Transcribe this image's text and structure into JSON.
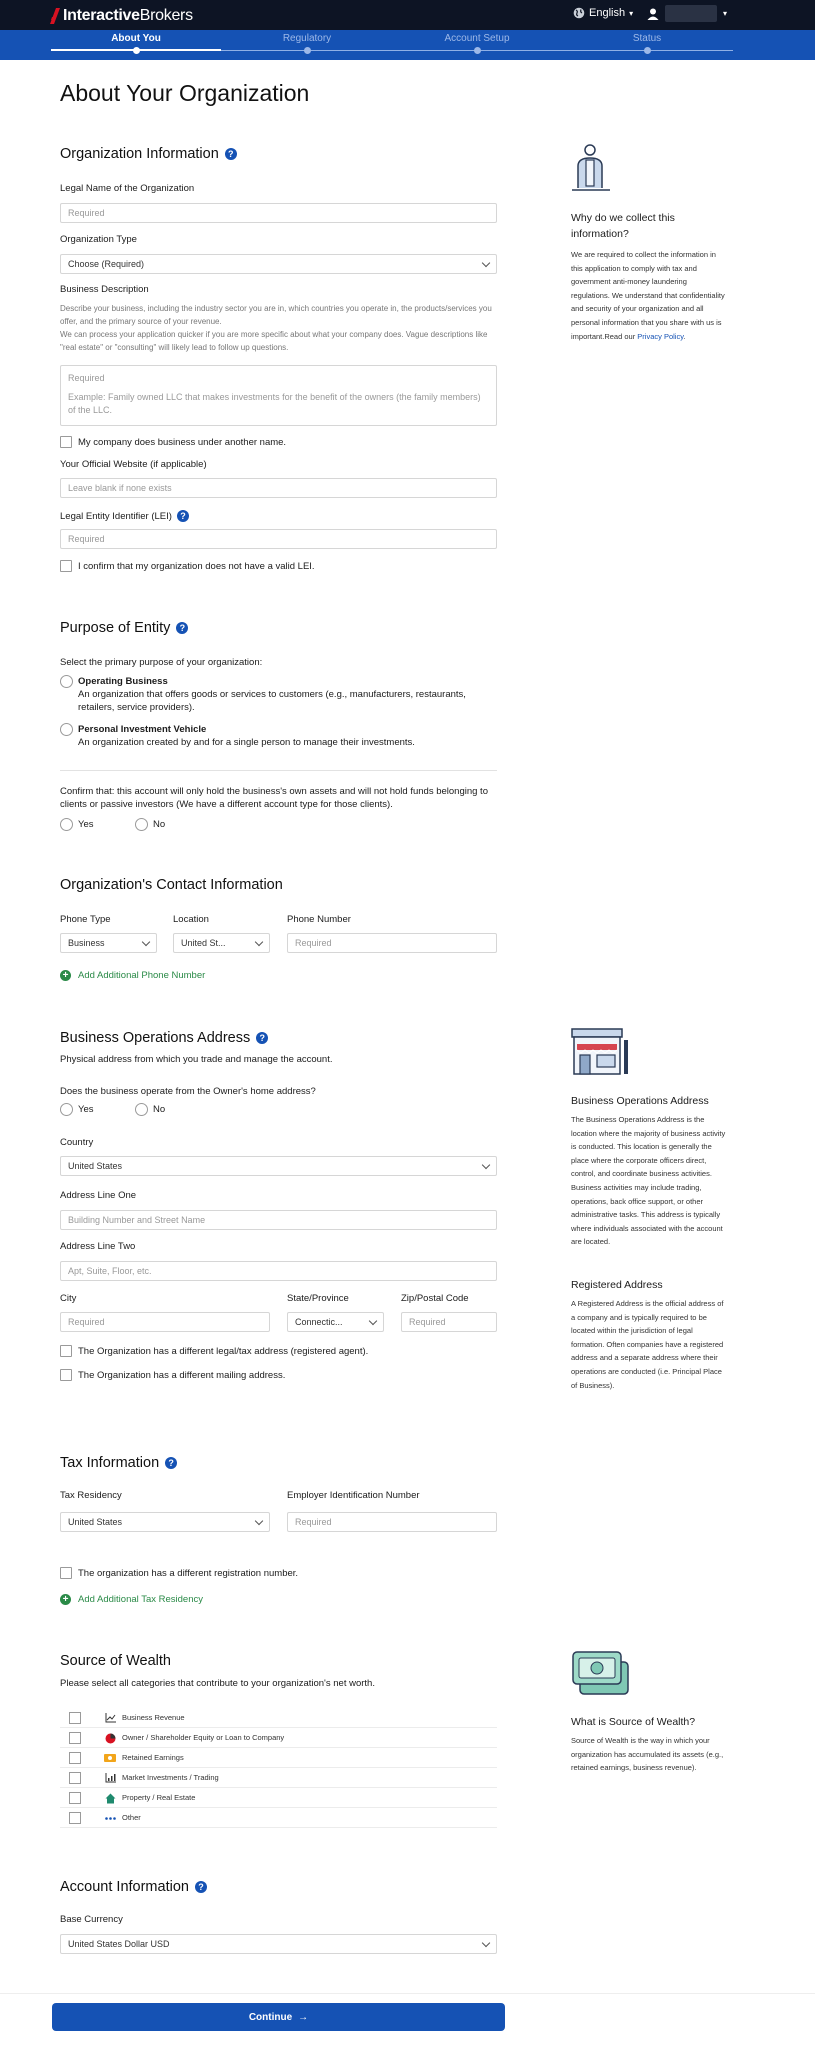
{
  "header": {
    "logo_bold": "Interactive",
    "logo_rest": "Brokers",
    "language": "English",
    "colors": {
      "topbar": "#0d1424",
      "brand_red": "#d81222",
      "primary": "#1552b4",
      "green": "#2a8a47"
    }
  },
  "steps": [
    {
      "label": "About You",
      "active": true
    },
    {
      "label": "Regulatory",
      "active": false
    },
    {
      "label": "Account Setup",
      "active": false
    },
    {
      "label": "Status",
      "active": false
    }
  ],
  "page_title": "About Your Organization",
  "org_info": {
    "heading": "Organization Information",
    "legal_name_label": "Legal Name of the Organization",
    "legal_name_placeholder": "Required",
    "org_type_label": "Organization Type",
    "org_type_value": "Choose (Required)",
    "business_desc_label": "Business Description",
    "business_desc_help_1": "Describe your business, including the industry sector you are in, which countries you operate in, the products/services you offer, and the primary source of your revenue.",
    "business_desc_help_2": "We can process your application quicker if you are more specific about what your company does. Vague descriptions like \"real estate\" or \"consulting\" will likely lead to follow up questions.",
    "business_desc_placeholder_1": "Required",
    "business_desc_placeholder_2": "Example: Family owned LLC that makes investments for the benefit of the owners (the family members) of the LLC.",
    "another_name_label": "My company does business under another name.",
    "website_label": "Your Official Website (if applicable)",
    "website_placeholder": "Leave blank if none exists",
    "lei_label": "Legal Entity Identifier (LEI)",
    "lei_placeholder": "Required",
    "no_lei_label": "I confirm that my organization does not have a valid LEI."
  },
  "side_why": {
    "title": "Why do we collect this information?",
    "text": "We are required to collect the information in this application to comply with tax and government anti-money laundering regulations. We understand that confidentiality and security of your organization and all personal information that you share with us is important.Read our ",
    "link": "Privacy Policy",
    "after": "."
  },
  "purpose": {
    "heading": "Purpose of Entity",
    "prompt": "Select the primary purpose of your organization:",
    "opt1_title": "Operating Business",
    "opt1_desc": "An organization that offers goods or services to customers (e.g., manufacturers, restaurants, retailers, service providers).",
    "opt2_title": "Personal Investment Vehicle",
    "opt2_desc": "An organization created by and for a single person to manage their investments.",
    "confirm_text": "Confirm that: this account will only hold the business's own assets and will not hold funds belonging to clients or passive investors (We have a different account type for those clients).",
    "yes": "Yes",
    "no": "No"
  },
  "contact": {
    "heading": "Organization's Contact Information",
    "phone_type_label": "Phone Type",
    "phone_type_value": "Business",
    "location_label": "Location",
    "location_value": "United St...",
    "phone_number_label": "Phone Number",
    "phone_number_placeholder": "Required",
    "add_phone": "Add Additional Phone Number"
  },
  "address": {
    "heading": "Business Operations Address",
    "subtitle": "Physical address from which you trade and manage the account.",
    "home_question": "Does the business operate from the Owner's home address?",
    "yes": "Yes",
    "no": "No",
    "country_label": "Country",
    "country_value": "United States",
    "line1_label": "Address Line One",
    "line1_placeholder": "Building Number and Street Name",
    "line2_label": "Address Line Two",
    "line2_placeholder": "Apt, Suite, Floor, etc.",
    "city_label": "City",
    "city_placeholder": "Required",
    "state_label": "State/Province",
    "state_value": "Connectic...",
    "zip_label": "Zip/Postal Code",
    "zip_placeholder": "Required",
    "diff_legal": "The Organization has a different legal/tax address (registered agent).",
    "diff_mailing": "The Organization has a different mailing address."
  },
  "side_address": {
    "title1": "Business Operations Address",
    "text1": "The Business Operations Address is the location where the majority of business activity is conducted. This location is generally the place where the corporate officers direct, control, and coordinate business activities. Business activities may include trading, operations, back office support, or other administrative tasks. This address is typically where individuals associated with the account are located.",
    "title2": "Registered Address",
    "text2": "A Registered Address is the official address of a company and is typically required to be located within the jurisdiction of legal formation. Often companies have a registered address and a separate address where their operations are conducted (i.e. Principal Place of Business)."
  },
  "tax": {
    "heading": "Tax Information",
    "residency_label": "Tax Residency",
    "residency_value": "United States",
    "ein_label": "Employer Identification Number",
    "ein_placeholder": "Required",
    "diff_reg": "The organization has a different registration number.",
    "add_tax": "Add Additional Tax Residency"
  },
  "wealth": {
    "heading": "Source of Wealth",
    "subtitle": "Please select all categories that contribute to your organization's net worth.",
    "items": [
      {
        "label": "Business Revenue",
        "icon": "chart-line-icon"
      },
      {
        "label": "Owner / Shareholder Equity or Loan to Company",
        "icon": "pie-chart-icon"
      },
      {
        "label": "Retained Earnings",
        "icon": "cash-icon"
      },
      {
        "label": "Market Investments / Trading",
        "icon": "bar-chart-icon"
      },
      {
        "label": "Property / Real Estate",
        "icon": "house-icon"
      },
      {
        "label": "Other",
        "icon": "dots-icon"
      }
    ]
  },
  "side_wealth": {
    "title": "What is Source of Wealth?",
    "text": "Source of Wealth is the way in which your organization has accumulated its assets (e.g., retained earnings, business revenue)."
  },
  "account": {
    "heading": "Account Information",
    "base_currency_label": "Base Currency",
    "base_currency_value": "United States Dollar USD"
  },
  "continue_label": "Continue"
}
